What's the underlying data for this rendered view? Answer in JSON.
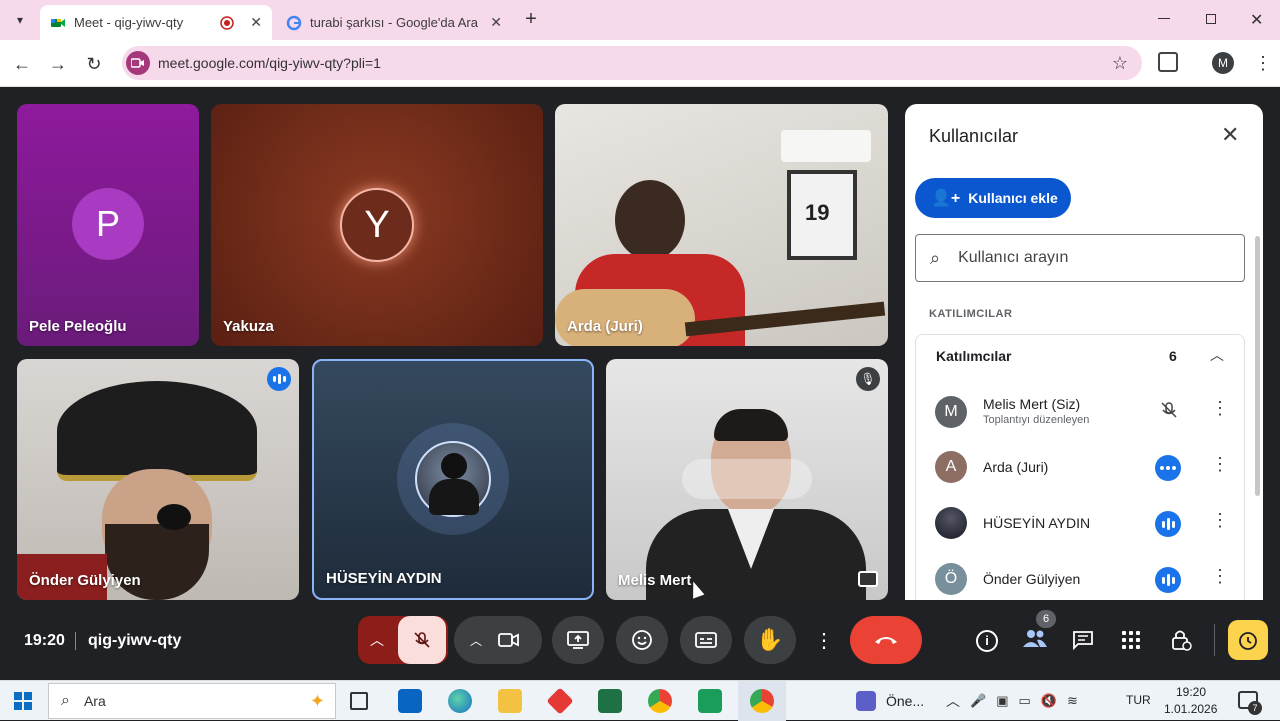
{
  "browser": {
    "tabs": [
      {
        "title": "Meet - qig-yiwv-qty",
        "active": true
      },
      {
        "title": "turabi şarkısı - Google'da Ara",
        "active": false
      }
    ],
    "new_tab": "+",
    "url": "meet.google.com/qig-yiwv-qty?pli=1",
    "profile_initial": "M",
    "accent": "#f7d9ec"
  },
  "tiles": [
    {
      "name": "Pele Peleoğlu",
      "initial": "P"
    },
    {
      "name": "Yakuza",
      "initial": "Y"
    },
    {
      "name": "Arda (Juri)",
      "video": true
    },
    {
      "name": "Önder Gülyiyen",
      "video": true
    },
    {
      "name": "HÜSEYİN AYDIN",
      "avatar_image": true
    },
    {
      "name": "Melis Mert",
      "video": true
    }
  ],
  "panel": {
    "title": "Kullanıcılar",
    "add_button": "Kullanıcı ekle",
    "search_placeholder": "Kullanıcı arayın",
    "section_label": "KATILIMCILAR",
    "group_label": "Katılımcılar",
    "count": "6",
    "participants": [
      {
        "name": "Melis Mert (Siz)",
        "subtitle": "Toplantıyı düzenleyen",
        "initial": "M",
        "avatar_color": "#5f6368",
        "status": "muted-mic-icon"
      },
      {
        "name": "Arda (Juri)",
        "subtitle": "",
        "initial": "A",
        "avatar_color": "#8d6e63",
        "status": "speaking-dots-icon"
      },
      {
        "name": "HÜSEYİN AYDIN",
        "subtitle": "",
        "initial": "",
        "avatar_color": "#263238",
        "status": "audio-wave-icon"
      },
      {
        "name": "Önder Gülyiyen",
        "subtitle": "",
        "initial": "Ö",
        "avatar_color": "#78909c",
        "status": "audio-wave-icon"
      }
    ]
  },
  "meeting": {
    "time": "19:20",
    "code": "qig-yiwv-qty",
    "people_badge": "6",
    "end_call_color": "#ea4335",
    "mic_off_color": "#f9dedc"
  },
  "taskbar": {
    "search_placeholder": "Ara",
    "weather_label": "Öne...",
    "language": "TUR",
    "clock_time": "19:20",
    "clock_date": "1.01.2026",
    "notification_count": "7"
  }
}
